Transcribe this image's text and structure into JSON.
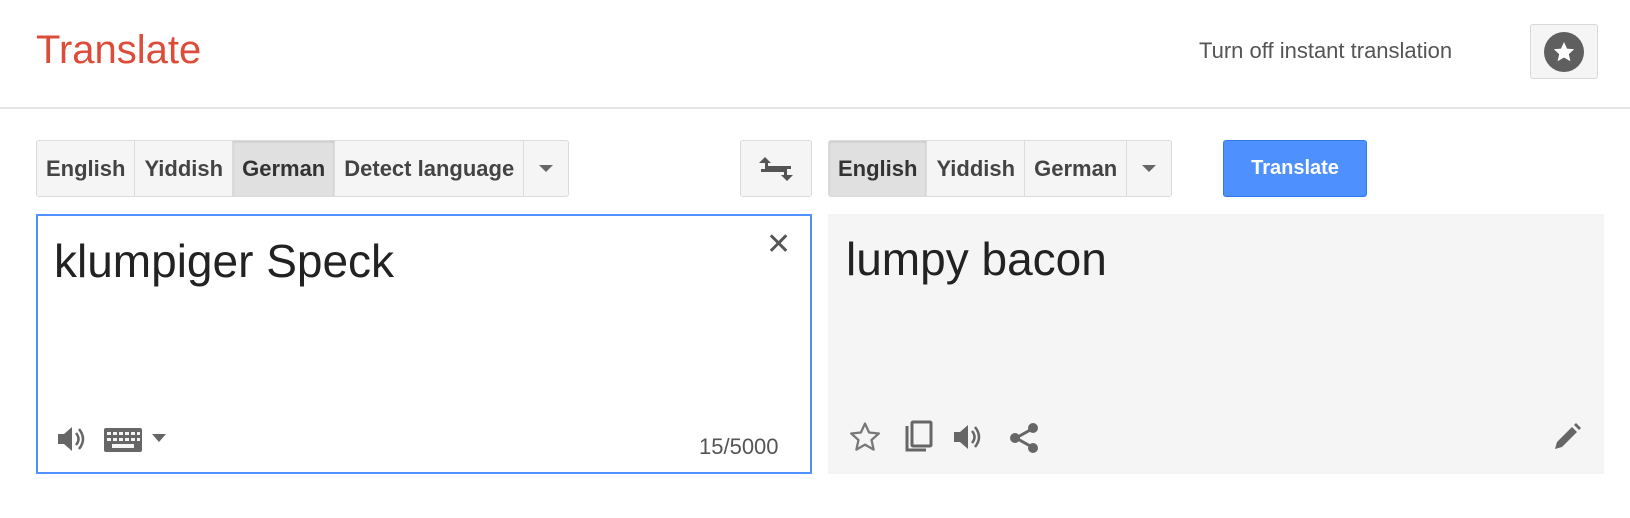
{
  "header": {
    "title": "Translate",
    "instant_link": "Turn off instant translation",
    "star_icon": "star-icon"
  },
  "source_langs": {
    "items": [
      {
        "label": "English",
        "selected": false
      },
      {
        "label": "Yiddish",
        "selected": false
      },
      {
        "label": "German",
        "selected": true
      },
      {
        "label": "Detect language",
        "selected": false
      }
    ]
  },
  "target_langs": {
    "items": [
      {
        "label": "English",
        "selected": true
      },
      {
        "label": "Yiddish",
        "selected": false
      },
      {
        "label": "German",
        "selected": false
      }
    ]
  },
  "translate_button": "Translate",
  "source": {
    "text": "klumpiger Speck",
    "char_count": "15/5000",
    "clear_symbol": "✕"
  },
  "target": {
    "text": "lumpy bacon"
  },
  "colors": {
    "accent_blue": "#4d90fe",
    "title_red": "#dd4b39"
  }
}
